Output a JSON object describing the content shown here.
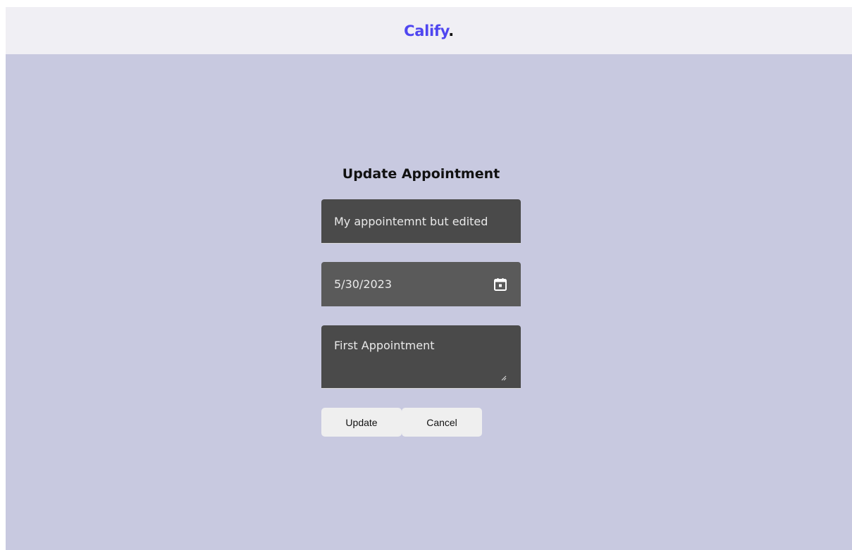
{
  "header": {
    "brand_name": "Calify",
    "brand_dot": "."
  },
  "form": {
    "title": "Update Appointment",
    "title_field_value": "My appointemnt but edited",
    "date_field_value": "5/30/2023",
    "notes_field_value": "First Appointment",
    "update_label": "Update",
    "cancel_label": "Cancel"
  },
  "icons": {
    "date_picker": "calendar-icon",
    "notes_resize": "resize-grip-icon"
  },
  "colors": {
    "brand": "#4f46f0",
    "header_bg": "#f0eff4",
    "page_bg": "#c8c9e0",
    "field_bg": "#4a4a4a",
    "button_bg": "#efefef"
  }
}
